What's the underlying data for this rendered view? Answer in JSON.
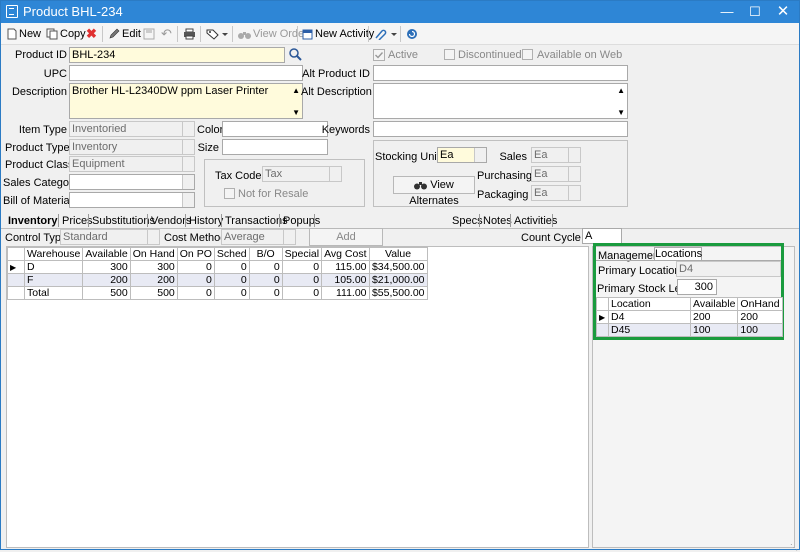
{
  "window": {
    "title": "Product BHL-234"
  },
  "toolbar": {
    "new": "New",
    "copy": "Copy",
    "edit": "Edit",
    "view_order": "View Order",
    "new_activity": "New Activity"
  },
  "form": {
    "product_id": {
      "label": "Product ID",
      "value": "BHL-234"
    },
    "upc": {
      "label": "UPC",
      "value": ""
    },
    "description": {
      "label": "Description",
      "value": "Brother HL-L2340DW ppm Laser Printer"
    },
    "item_type": {
      "label": "Item Type",
      "value": "Inventoried"
    },
    "product_type": {
      "label": "Product Type",
      "value": "Inventory"
    },
    "product_class": {
      "label": "Product Class",
      "value": "Equipment"
    },
    "sales_category": {
      "label": "Sales Category",
      "value": ""
    },
    "bill_of_materials": {
      "label": "Bill of Materials",
      "value": ""
    },
    "color": {
      "label": "Color",
      "value": ""
    },
    "size": {
      "label": "Size",
      "value": ""
    },
    "tax_code": {
      "label": "Tax Code",
      "value": "Tax"
    },
    "not_for_resale": {
      "label": "Not for Resale"
    },
    "active": {
      "label": "Active"
    },
    "discontinued": {
      "label": "Discontinued"
    },
    "available_on_web": {
      "label": "Available on Web"
    },
    "alt_product_id": {
      "label": "Alt Product ID",
      "value": ""
    },
    "alt_description": {
      "label": "Alt Description",
      "value": ""
    },
    "keywords": {
      "label": "Keywords",
      "value": ""
    },
    "stocking_unit": {
      "label": "Stocking Unit",
      "value": "Ea"
    },
    "sales": {
      "label": "Sales",
      "value": "Ea"
    },
    "purchasing": {
      "label": "Purchasing",
      "value": "Ea"
    },
    "packaging": {
      "label": "Packaging",
      "value": "Ea"
    },
    "view_alternates": "View Alternates"
  },
  "tabs": {
    "left": [
      "Inventory",
      "Prices",
      "Substitutions",
      "Vendors",
      "History",
      "Transactions",
      "Popups"
    ],
    "right": [
      "Specs",
      "Notes",
      "Activities"
    ]
  },
  "inventory": {
    "control_type": {
      "label": "Control Type",
      "value": "Standard"
    },
    "cost_method": {
      "label": "Cost Method",
      "value": "Average"
    },
    "add_warehouse": "Add Warehouse",
    "count_cycle": {
      "label": "Count Cycle",
      "value": "A"
    },
    "columns": [
      "Warehouse",
      "Available",
      "On Hand",
      "On PO",
      "Sched",
      "B/O",
      "Special",
      "Avg Cost",
      "Value"
    ],
    "rows": [
      [
        "D",
        "300",
        "300",
        "0",
        "0",
        "0",
        "0",
        "115.00",
        "$34,500.00"
      ],
      [
        "F",
        "200",
        "200",
        "0",
        "0",
        "0",
        "0",
        "105.00",
        "$21,000.00"
      ],
      [
        "Total",
        "500",
        "500",
        "0",
        "0",
        "0",
        "0",
        "111.00",
        "$55,500.00"
      ]
    ]
  },
  "locations": {
    "tabs": [
      "Management",
      "Locations"
    ],
    "primary_location": {
      "label": "Primary Location",
      "value": "D4"
    },
    "primary_stock_level": {
      "label": "Primary Stock Level",
      "value": "300"
    },
    "columns": [
      "Location",
      "Available",
      "OnHand"
    ],
    "rows": [
      [
        "D4",
        "200",
        "200"
      ],
      [
        "D45",
        "100",
        "100"
      ]
    ],
    "highlight_color": "#1a9b3e"
  }
}
